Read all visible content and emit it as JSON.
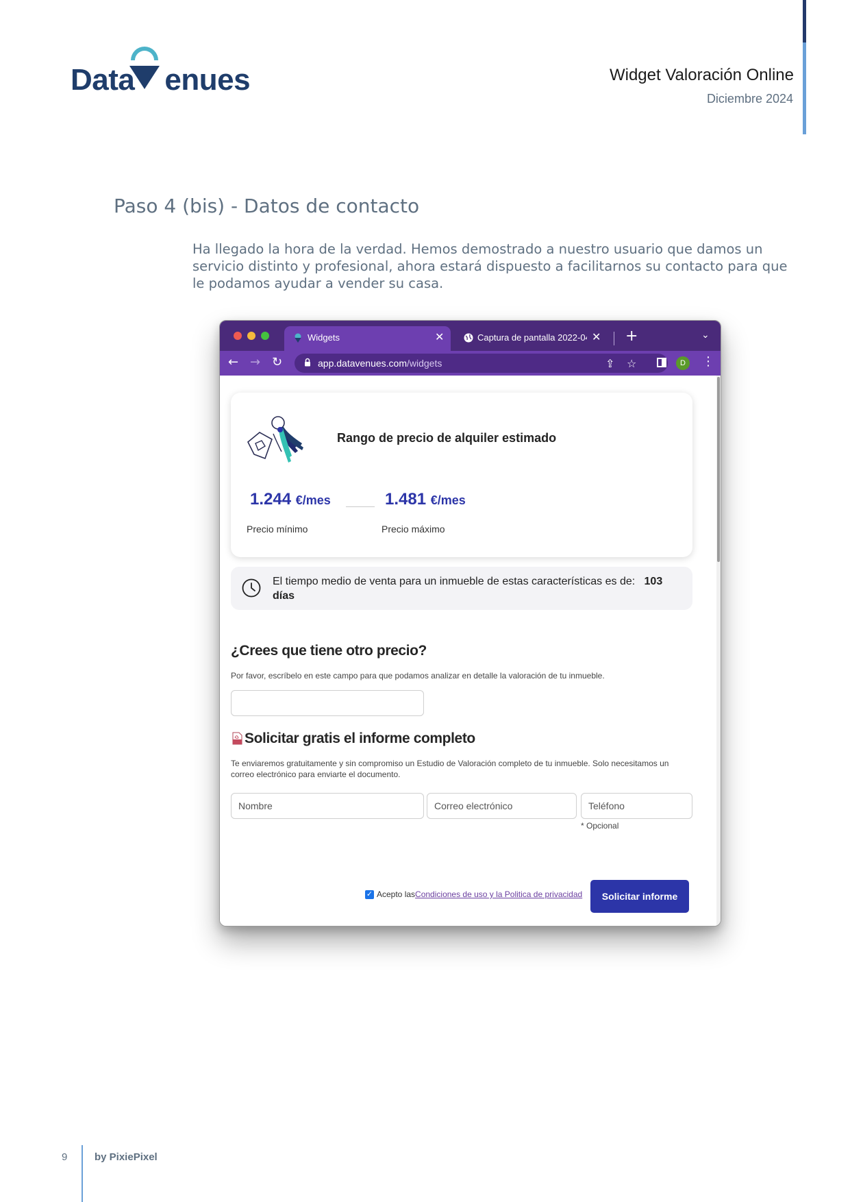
{
  "header": {
    "logo_text_left": "Data",
    "logo_text_right": "enues",
    "title": "Widget Valoración Online",
    "date": "Diciembre 2024"
  },
  "section": {
    "title": "Paso 4 (bis) - Datos de contacto",
    "intro": "Ha llegado la hora de la verdad. Hemos demostrado a nuestro usuario que damos un servicio distinto y profesional, ahora estará dispuesto a facilitarnos su contacto para que le podamos ayudar a vender su casa."
  },
  "browser": {
    "tabs": [
      {
        "label": "Widgets",
        "active": true
      },
      {
        "label": "Captura de pantalla 2022-04-2",
        "active": false
      }
    ],
    "url_host": "app.datavenues.com",
    "url_path": "/widgets",
    "profile_initial": "D"
  },
  "widget": {
    "card_title": "Rango de precio de alquiler estimado",
    "price_min": "1.244",
    "price_max": "1.481",
    "price_unit": "€/mes",
    "price_min_label": "Precio mínimo",
    "price_max_label": "Precio máximo",
    "time_text": "El tiempo medio de venta para un inmueble de estas características es de:",
    "time_days": "103 días",
    "other_price_heading": "¿Crees que tiene otro precio?",
    "other_price_help": "Por favor, escríbelo en este campo para que podamos analizar en detalle la valoración de tu inmueble.",
    "report_heading": "Solicitar gratis el informe completo",
    "report_help": "Te enviaremos gratuitamente y sin compromiso un Estudio de Valoración completo de tu inmueble. Solo necesitamos un correo electrónico para enviarte el documento.",
    "name_placeholder": "Nombre",
    "email_placeholder": "Correo electrónico",
    "phone_placeholder": "Teléfono",
    "optional_note": "* Opcional",
    "consent_prefix": "Acepto las",
    "consent_link": "Condiciones de uso y la Politica de privacidad",
    "submit_label": "Solicitar informe"
  },
  "footer": {
    "page_number": "9",
    "brand": "by PixiePixel"
  },
  "colors": {
    "brand_navy": "#1f3d6b",
    "brand_teal": "#4db3c9",
    "browser_purple": "#6d3fb0",
    "button_blue": "#2c35a8"
  }
}
